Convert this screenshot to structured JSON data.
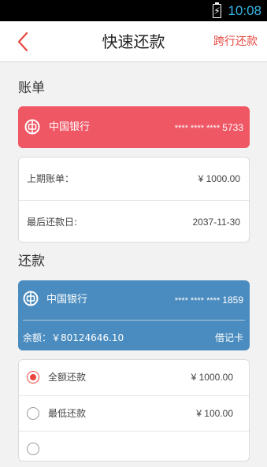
{
  "status_bar": {
    "time": "10:08"
  },
  "nav": {
    "title": "快速还款",
    "right_link": "跨行还款"
  },
  "bill_section": {
    "label": "账单",
    "card": {
      "bank": "中国银行",
      "number_mask": "**** **** ****",
      "number_tail": "5733",
      "color": "#ef5765"
    },
    "rows": [
      {
        "label": "上期账单：",
        "value": "¥ 1000.00"
      },
      {
        "label": "最后还款日:",
        "value": "2037-11-30"
      }
    ]
  },
  "repay_section": {
    "label": "还款",
    "card": {
      "bank": "中国银行",
      "number_mask": "**** **** ****",
      "number_tail": "1859",
      "balance": "余额：￥80124646.10",
      "type": "借记卡",
      "color": "#4a8cbf"
    },
    "options": [
      {
        "label": "全额还款",
        "value": "¥ 1000.00",
        "selected": true
      },
      {
        "label": "最低还款",
        "value": "¥ 100.00",
        "selected": false
      }
    ]
  },
  "colors": {
    "accent": "#e8473f"
  }
}
